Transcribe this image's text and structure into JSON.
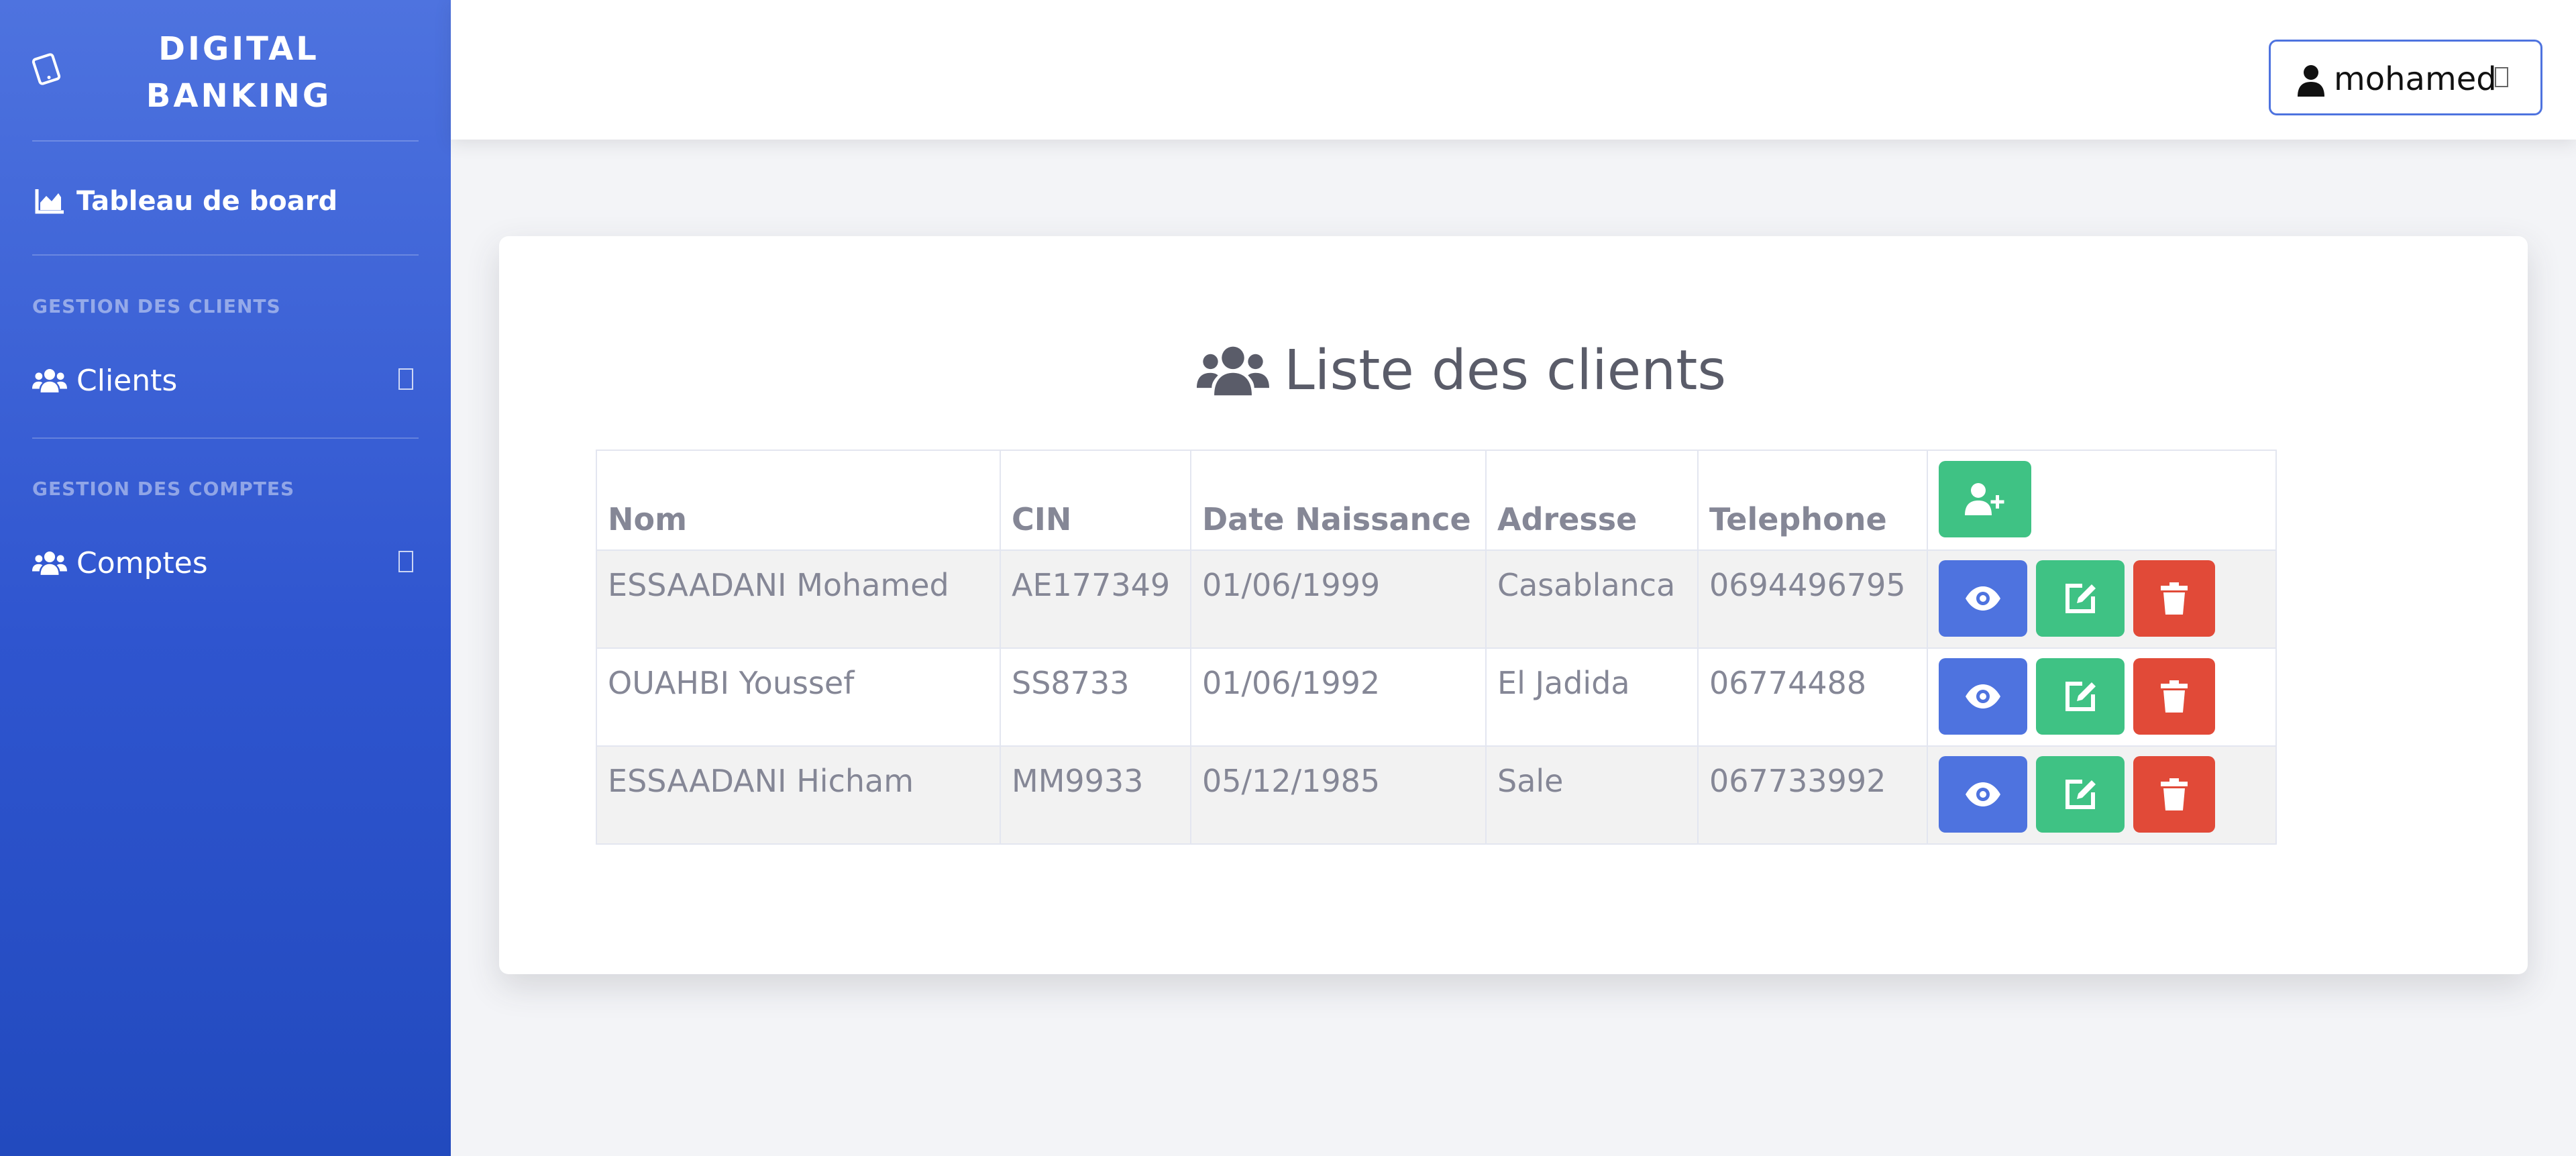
{
  "sidebar": {
    "brand": "DIGITAL\nBANKING",
    "dashboard_label": "Tableau de board",
    "section_clients": "GESTION DES CLIENTS",
    "clients_label": "Clients",
    "section_comptes": "GESTION DES COMPTES",
    "comptes_label": "Comptes"
  },
  "topbar": {
    "user_name": "mohamed"
  },
  "main": {
    "title": "Liste des clients",
    "table": {
      "columns": [
        "Nom",
        "CIN",
        "Date Naissance",
        "Adresse",
        "Telephone"
      ],
      "rows": [
        [
          "ESSAADANI Mohamed",
          "AE177349",
          "01/06/1999",
          "Casablanca",
          "0694496795"
        ],
        [
          "OUAHBI Youssef",
          "SS8733",
          "01/06/1992",
          "El Jadida",
          "06774488"
        ],
        [
          "ESSAADANI Hicham",
          "MM9933",
          "05/12/1985",
          "Sale",
          "067733992"
        ]
      ]
    }
  },
  "icons": {
    "brand": "tablet-icon",
    "dashboard": "area-chart-icon",
    "clients": "users-icon",
    "comptes": "users-icon",
    "user": "user-icon",
    "title": "users-icon",
    "add": "user-plus-icon",
    "view": "eye-icon",
    "edit": "edit-icon",
    "delete": "trash-icon"
  },
  "colors": {
    "sidebar": "#4e73df",
    "primary": "#4e73df",
    "success": "#3fc284",
    "danger": "#e14a38"
  }
}
